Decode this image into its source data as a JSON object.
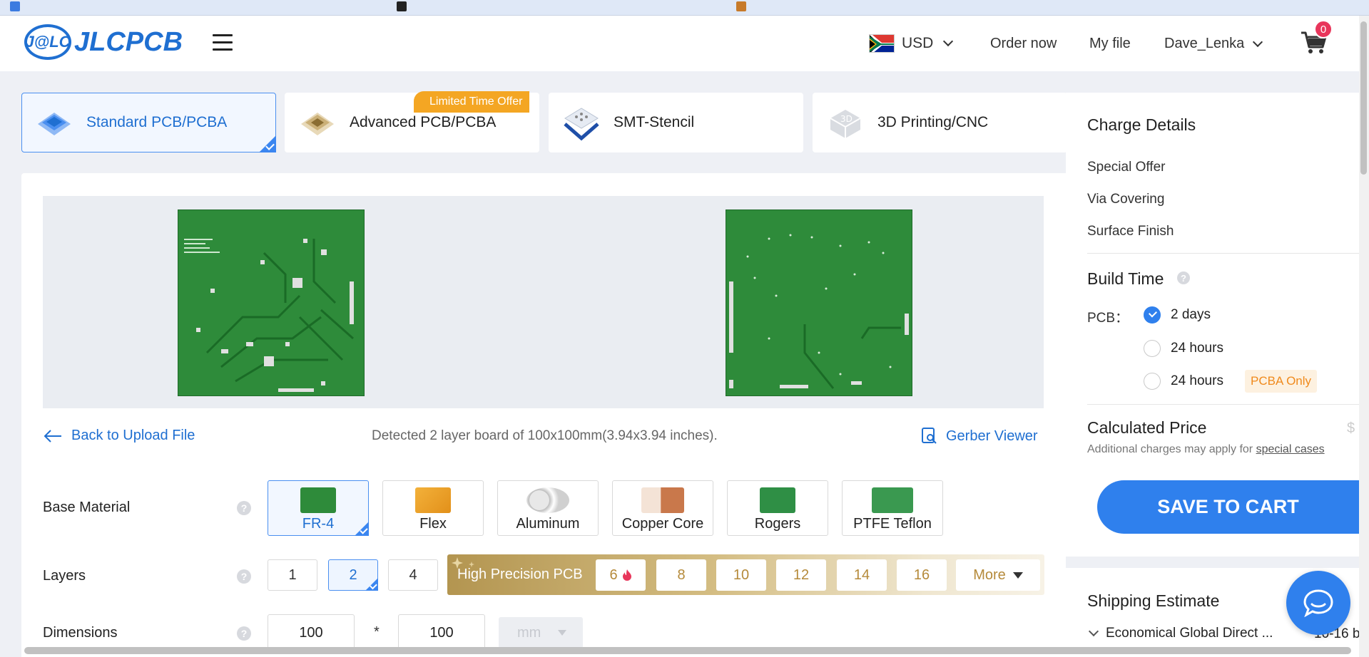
{
  "header": {
    "logo_badge": "J@LC",
    "logo_text": "JLCPCB",
    "currency": "USD",
    "nav": [
      "Order now",
      "My file"
    ],
    "user": "Dave_Lenka",
    "cart_count": "0"
  },
  "tabs": [
    {
      "label": "Standard PCB/PCBA",
      "active": true
    },
    {
      "label": "Advanced PCB/PCBA",
      "active": false
    },
    {
      "label": "SMT-Stencil",
      "active": false
    },
    {
      "label": "3D Printing/CNC",
      "active": false
    }
  ],
  "offer_badge": "Limited Time Offer",
  "upload": {
    "back_label": "Back to Upload File",
    "detected": "Detected 2 layer board of 100x100mm(3.94x3.94 inches).",
    "gerber_label": "Gerber Viewer"
  },
  "base_material": {
    "label": "Base Material",
    "help": "?",
    "options": [
      "FR-4",
      "Flex",
      "Aluminum",
      "Copper Core",
      "Rogers",
      "PTFE Teflon"
    ],
    "selected": "FR-4"
  },
  "layers": {
    "label": "Layers",
    "help": "?",
    "options": [
      "1",
      "2",
      "4"
    ],
    "selected": "2",
    "high_precision_title": "High Precision PCB",
    "high_precision_options": [
      "6",
      "8",
      "10",
      "12",
      "14",
      "16"
    ],
    "more_label": "More"
  },
  "dimensions": {
    "label": "Dimensions",
    "help": "?",
    "width": "100",
    "times": "*",
    "height": "100",
    "unit": "mm"
  },
  "sidebar": {
    "charge_title": "Charge Details",
    "charges": [
      "Special Offer",
      "Via Covering",
      "Surface Finish"
    ],
    "build_title": "Build Time",
    "build_help": "?",
    "pcb_label": "PCB：",
    "build_options": [
      {
        "label": "2 days",
        "checked": true
      },
      {
        "label": "24 hours",
        "checked": false
      },
      {
        "label": "24 hours",
        "checked": false
      }
    ],
    "pcba_only": "PCBA Only",
    "calc_title": "Calculated Price",
    "calc_currency": "$",
    "calc_note": "Additional charges may apply for",
    "calc_note_link": "special cases",
    "save_label": "SAVE TO CART",
    "shipping_title": "Shipping Estimate",
    "shipping_method": "Economical Global Direct ...",
    "shipping_days": "10-16 b"
  },
  "colors": {
    "accent": "#2f80ed",
    "board_green": "#2e8b3a",
    "gold": "#b39550",
    "offer_orange": "#f4a623"
  }
}
